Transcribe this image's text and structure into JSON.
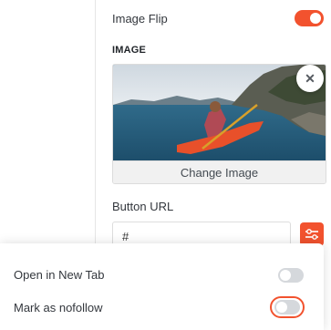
{
  "image_flip": {
    "label": "Image Flip",
    "enabled": true
  },
  "image_section": {
    "heading": "IMAGE",
    "change_label": "Change Image",
    "remove_symbol": "✕"
  },
  "button_url": {
    "label": "Button URL",
    "value": "#"
  },
  "link_options": {
    "new_tab": {
      "label": "Open in New Tab",
      "enabled": false
    },
    "nofollow": {
      "label": "Mark as nofollow",
      "enabled": false
    }
  },
  "colors": {
    "accent": "#f2522e",
    "toggle_off": "#d5d8dc"
  },
  "icons": {
    "remove": "close-icon",
    "link_settings": "sliders-icon"
  }
}
